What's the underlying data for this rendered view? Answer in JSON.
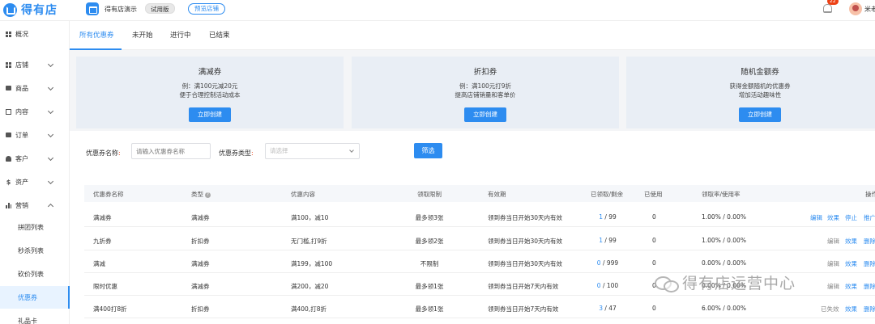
{
  "header": {
    "logo_text": "得有店",
    "shop_name": "得有店演示",
    "trial_badge": "试用版",
    "preview_button": "预览店铺",
    "notify_count": "22",
    "user_name": "米老"
  },
  "sidebar": {
    "items": [
      {
        "label": "概况",
        "icon": "dashboard-icon"
      },
      {
        "label": "店铺",
        "icon": "store-icon"
      },
      {
        "label": "商品",
        "icon": "goods-icon"
      },
      {
        "label": "内容",
        "icon": "content-icon"
      },
      {
        "label": "订单",
        "icon": "order-icon"
      },
      {
        "label": "客户",
        "icon": "customer-icon"
      },
      {
        "label": "资产",
        "icon": "asset-icon"
      },
      {
        "label": "营销",
        "icon": "marketing-icon"
      }
    ],
    "marketing_sub": [
      "拼团列表",
      "秒杀列表",
      "砍价列表",
      "优惠券",
      "礼品卡"
    ]
  },
  "tabs": [
    "所有优惠券",
    "未开始",
    "进行中",
    "已结束"
  ],
  "cards": [
    {
      "title": "满减券",
      "desc1": "例：满100元减20元",
      "desc2": "便于合理控制活动成本",
      "button": "立即创建"
    },
    {
      "title": "折扣券",
      "desc1": "例：满100元打9折",
      "desc2": "提高店铺销量和客单价",
      "button": "立即创建"
    },
    {
      "title": "随机金额券",
      "desc1": "获得金额随机的优惠券",
      "desc2": "增加活动趣味性",
      "button": "立即创建"
    }
  ],
  "filter": {
    "name_label": "优惠券名称",
    "name_placeholder": "请输入优惠券名称",
    "type_label": "优惠券类型",
    "type_placeholder": "请选择",
    "button": "筛选"
  },
  "table": {
    "headers": [
      "优惠券名称",
      "类型",
      "优惠内容",
      "领取限制",
      "有效期",
      "已领取/剩余",
      "已使用",
      "领取率/使用率",
      "操作"
    ],
    "rows": [
      {
        "name": "满减券",
        "type": "满减券",
        "content": "满100，减10",
        "limit": "最多领3张",
        "validity": "领到券当日开始30天内有效",
        "received": "1",
        "remaining": " / 99",
        "used": "0",
        "rate": "1.00% / 0.00%",
        "actions": [
          "编辑",
          "效果",
          "停止",
          "推广"
        ]
      },
      {
        "name": "九折券",
        "type": "折扣券",
        "content": "无门槛,打9折",
        "limit": "最多领2张",
        "validity": "领到券当日开始30天内有效",
        "received": "1",
        "remaining": " / 99",
        "used": "0",
        "rate": "1.00% / 0.00%",
        "actions": [
          "编辑",
          "效果",
          "删除"
        ]
      },
      {
        "name": "满减",
        "type": "满减券",
        "content": "满199，减100",
        "limit": "不限制",
        "validity": "领到券当日开始30天内有效",
        "received": "0",
        "remaining": " / 999",
        "used": "0",
        "rate": "0.00% / 0.00%",
        "actions": [
          "编辑",
          "效果",
          "删除"
        ]
      },
      {
        "name": "限时优惠",
        "type": "满减券",
        "content": "满200，减20",
        "limit": "最多领1张",
        "validity": "领到券当日开始7天内有效",
        "received": "0",
        "remaining": " / 100",
        "used": "0",
        "rate": "0.00% / 0.00%",
        "actions": [
          "编辑",
          "效果",
          "删除"
        ]
      },
      {
        "name": "满400打8折",
        "type": "折扣券",
        "content": "满400,打8折",
        "limit": "最多领1张",
        "validity": "领到券当日开始7天内有效",
        "received": "3",
        "remaining": " / 47",
        "used": "0",
        "rate": "6.00% / 0.00%",
        "actions": [
          "已失效",
          "效果",
          "删除"
        ]
      }
    ]
  },
  "watermark": "得有店运营中心"
}
